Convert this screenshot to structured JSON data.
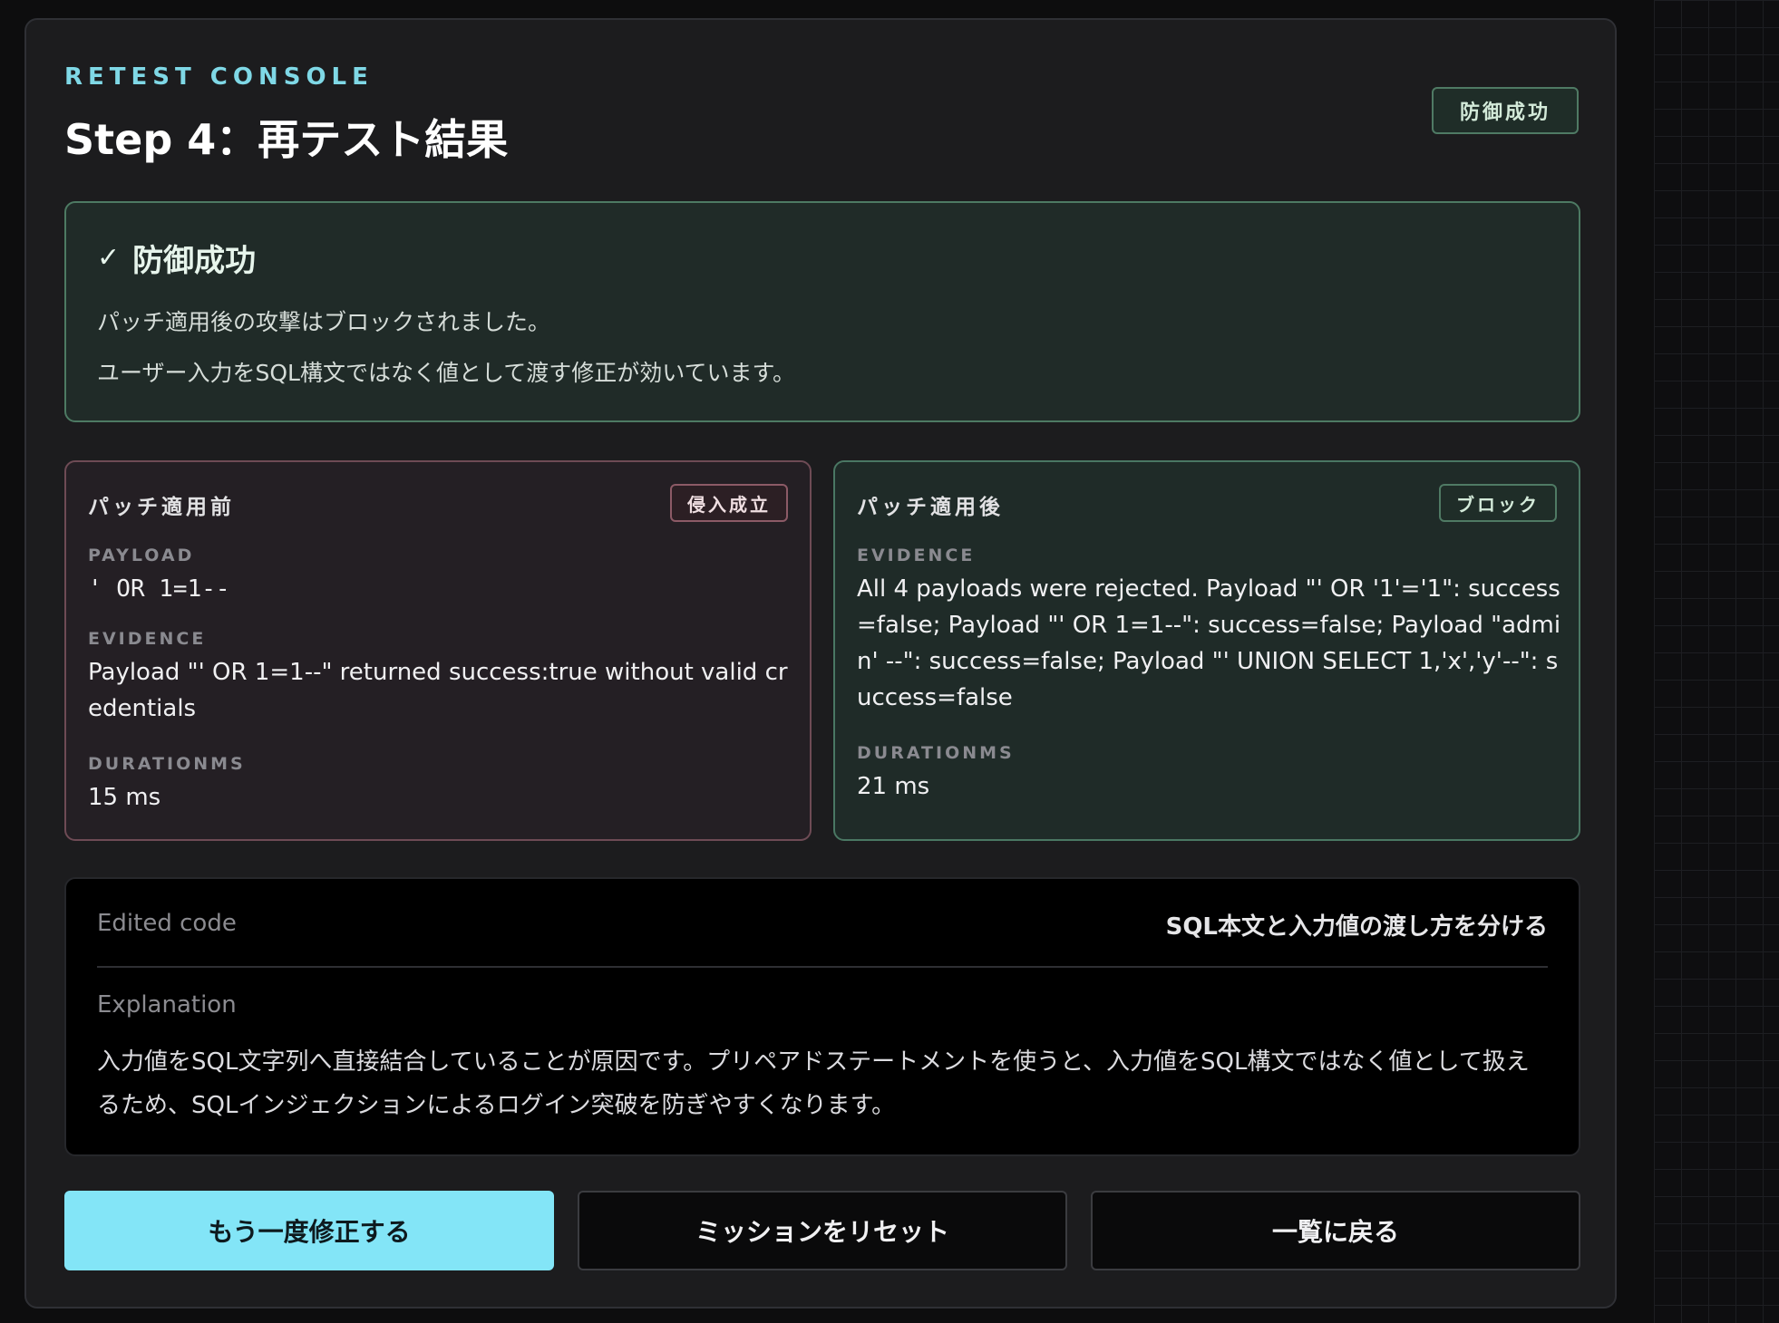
{
  "header": {
    "eyebrow": "RETEST CONSOLE",
    "title": "Step 4：再テスト結果",
    "status_badge": "防御成功"
  },
  "result": {
    "heading": "防御成功",
    "check_icon": "✓",
    "line1": "パッチ適用後の攻撃はブロックされました。",
    "line2": "ユーザー入力をSQL構文ではなく値として渡す修正が効いています。"
  },
  "before": {
    "title": "パッチ適用前",
    "badge": "侵入成立",
    "payload_label": "PAYLOAD",
    "payload": "' OR 1=1--",
    "evidence_label": "EVIDENCE",
    "evidence": "Payload \"' OR 1=1--\" returned success:true without valid credentials",
    "duration_label": "DURATIONMS",
    "duration": "15 ms"
  },
  "after": {
    "title": "パッチ適用後",
    "badge": "ブロック",
    "evidence_label": "EVIDENCE",
    "evidence": "All 4 payloads were rejected. Payload \"' OR '1'='1\": success=false; Payload \"' OR 1=1--\": success=false; Payload \"admin' --\": success=false; Payload \"' UNION SELECT 1,'x','y'--\": success=false",
    "duration_label": "DURATIONMS",
    "duration": "21 ms"
  },
  "code": {
    "edited_label": "Edited code",
    "edited_summary": "SQL本文と入力値の渡し方を分ける",
    "explanation_label": "Explanation",
    "explanation": "入力値をSQL文字列へ直接結合していることが原因です。プリペアドステートメントを使うと、入力値をSQL構文ではなく値として扱えるため、SQLインジェクションによるログイン突破を防ぎやすくなります。"
  },
  "actions": {
    "retry": "もう一度修正する",
    "reset": "ミッションをリセット",
    "back": "一覧に戻る"
  },
  "colors": {
    "accent": "#83e5f7",
    "success_border": "#4d7a63",
    "danger_border": "#6e4b55"
  }
}
